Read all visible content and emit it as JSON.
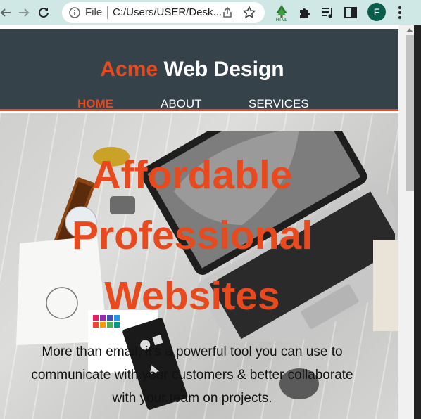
{
  "browser": {
    "scheme_label": "File",
    "url": "C:/Users/USER/Desk...",
    "profile_initial": "F",
    "icons": [
      "back-arrow-icon",
      "forward-arrow-icon",
      "reload-icon",
      "info-icon",
      "share-icon",
      "star-icon",
      "html-extension-icon",
      "puzzle-icon",
      "media-control-icon",
      "side-panel-icon",
      "kebab-menu-icon"
    ]
  },
  "site": {
    "brand_highlight": "Acme",
    "brand_rest": " Web Design",
    "nav": [
      "HOME",
      "ABOUT",
      "SERVICES"
    ],
    "active_nav": "HOME",
    "showcase_title_line1": "Affordable",
    "showcase_title_line2": "Professional",
    "showcase_title_line3": "Websites",
    "showcase_text": "More than email, it's a powerful tool you can use to communicate with your customers & better collaborate with your team on projects.",
    "colors": {
      "accent": "#e8491d",
      "header_bg": "#35424a",
      "text_light": "#ffffff"
    }
  }
}
